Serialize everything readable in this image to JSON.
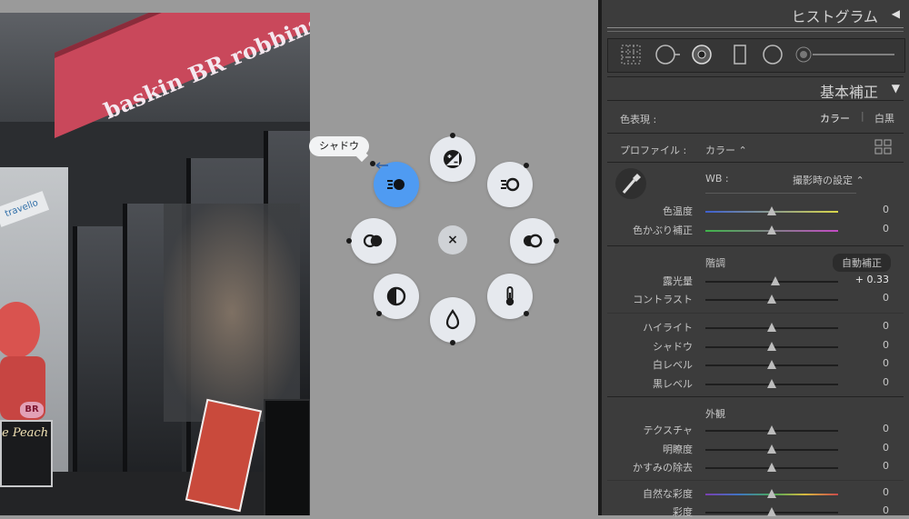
{
  "photo": {
    "sign_text": "baskin BR robbins",
    "badge_text": "BR",
    "peach_text": "e Peach",
    "small_sign_text": "travello"
  },
  "radial_menu": {
    "tooltip": "シャドウ",
    "close_label": "×",
    "active_item": "shadows",
    "items": [
      "exposure",
      "highlights",
      "whites",
      "temperature",
      "tint",
      "contrast",
      "blacks",
      "shadows"
    ]
  },
  "panel": {
    "histogram_title": "ヒストグラム",
    "basic_title": "基本補正",
    "collapse_glyph": "◀",
    "expand_glyph": "▼",
    "color_mode_label": "色表現 :",
    "color_option": "カラー",
    "bw_option": "白黒",
    "profile_label": "プロファイル :",
    "profile_value": "カラー ⌃",
    "wb_label": "WB :",
    "wb_value": "撮影時の設定 ⌃",
    "tone_label": "階調",
    "auto_button": "自動補正",
    "presence_label": "外観",
    "sliders": [
      {
        "label": "色温度",
        "value": "0",
        "position": 0.5
      },
      {
        "label": "色かぶり補正",
        "value": "0",
        "position": 0.5
      },
      {
        "label": "露光量",
        "value": "+ 0.33",
        "position": 0.53
      },
      {
        "label": "コントラスト",
        "value": "0",
        "position": 0.5
      },
      {
        "label": "ハイライト",
        "value": "0",
        "position": 0.5
      },
      {
        "label": "シャドウ",
        "value": "0",
        "position": 0.5
      },
      {
        "label": "白レベル",
        "value": "0",
        "position": 0.5
      },
      {
        "label": "黒レベル",
        "value": "0",
        "position": 0.5
      },
      {
        "label": "テクスチャ",
        "value": "0",
        "position": 0.5
      },
      {
        "label": "明瞭度",
        "value": "0",
        "position": 0.5
      },
      {
        "label": "かすみの除去",
        "value": "0",
        "position": 0.5
      },
      {
        "label": "自然な彩度",
        "value": "0",
        "position": 0.5
      },
      {
        "label": "彩度",
        "value": "0",
        "position": 0.5
      }
    ],
    "colors": {
      "background": "#3c3c3c",
      "accent_blue": "#4f9bf2",
      "temp_gradient_start": "#3d5fcf",
      "temp_gradient_end": "#d8d64a",
      "tint_gradient_start": "#3fb44a",
      "tint_gradient_end": "#c34bc4"
    }
  }
}
